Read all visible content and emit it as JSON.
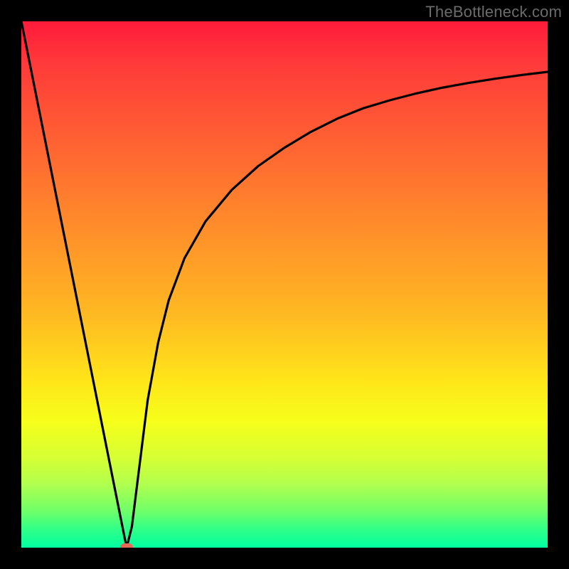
{
  "watermark": "TheBottleneck.com",
  "colors": {
    "background": "#000000",
    "curve": "#000000",
    "point": "#e56a5a"
  },
  "chart_data": {
    "type": "line",
    "title": "",
    "xlabel": "",
    "ylabel": "",
    "xlim": [
      0,
      100
    ],
    "ylim": [
      0,
      100
    ],
    "grid": false,
    "legend": false,
    "series": [
      {
        "name": "curve",
        "x": [
          0,
          2,
          4,
          6,
          8,
          10,
          12,
          14,
          16,
          18,
          19,
          20,
          21,
          22,
          23,
          24,
          26,
          28,
          31,
          35,
          40,
          45,
          50,
          55,
          60,
          65,
          70,
          75,
          80,
          85,
          90,
          95,
          100
        ],
        "y": [
          100,
          90,
          80,
          70,
          60,
          50,
          40,
          30,
          20,
          10,
          5,
          0,
          4,
          12,
          20,
          28,
          39,
          47,
          55,
          62,
          68,
          72.5,
          76,
          79,
          81.5,
          83.5,
          85,
          86.3,
          87.4,
          88.3,
          89.1,
          89.8,
          90.4
        ]
      }
    ],
    "highlight_point": {
      "x": 20,
      "y": 0
    }
  }
}
